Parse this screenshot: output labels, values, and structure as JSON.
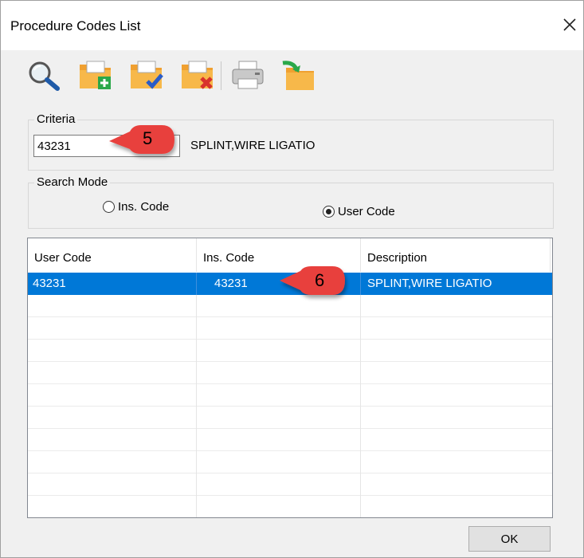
{
  "window": {
    "title": "Procedure Codes List"
  },
  "toolbar": {
    "items": [
      {
        "name": "search-icon"
      },
      {
        "name": "folder-add-icon"
      },
      {
        "name": "folder-edit-icon"
      },
      {
        "name": "folder-delete-icon"
      },
      {
        "name": "printer-icon"
      },
      {
        "name": "folder-export-icon"
      }
    ]
  },
  "criteria": {
    "label": "Criteria",
    "value": "43231",
    "description": "SPLINT,WIRE LIGATIO"
  },
  "search_mode": {
    "label": "Search Mode",
    "options": [
      {
        "label": "Ins. Code",
        "checked": false
      },
      {
        "label": "User Code",
        "checked": true
      }
    ]
  },
  "table": {
    "columns": [
      "User Code",
      "Ins. Code",
      "Description"
    ],
    "rows": [
      {
        "user_code": "43231",
        "ins_code": "43231",
        "description": "SPLINT,WIRE LIGATIO",
        "selected": true
      }
    ],
    "empty_rows": 10
  },
  "callouts": [
    "5",
    "6"
  ],
  "footer": {
    "ok_label": "OK"
  },
  "colors": {
    "selection": "#0078d7",
    "callout": "#e8413c"
  }
}
